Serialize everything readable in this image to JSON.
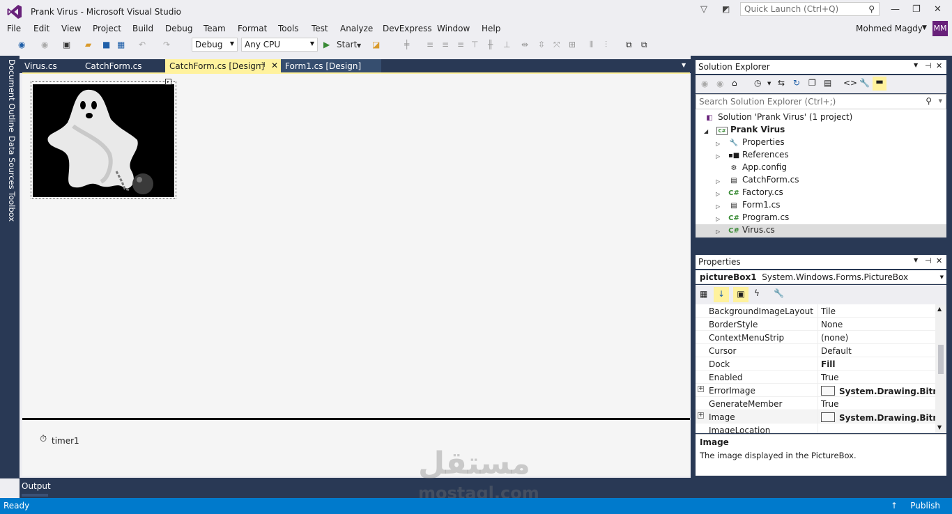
{
  "window": {
    "title": "Prank Virus - Microsoft Visual Studio",
    "quick_launch_placeholder": "Quick Launch (Ctrl+Q)"
  },
  "menu": [
    "File",
    "Edit",
    "View",
    "Project",
    "Build",
    "Debug",
    "Team",
    "Format",
    "Tools",
    "Test",
    "Analyze",
    "DevExpress",
    "Window",
    "Help"
  ],
  "user": {
    "name": "Mohmed Magdy",
    "initials": "MM"
  },
  "toolbar": {
    "config": "Debug",
    "platform": "Any CPU",
    "start": "Start"
  },
  "left_tabs": [
    "Document Outline",
    "Data Sources",
    "Toolbox"
  ],
  "tabs": [
    {
      "label": "Virus.cs"
    },
    {
      "label": "CatchForm.cs"
    },
    {
      "label": "CatchForm.cs [Design]",
      "pin": "⊣",
      "close": "✕"
    },
    {
      "label": "Form1.cs [Design]"
    }
  ],
  "designer": {
    "component": "timer1"
  },
  "output": {
    "label": "Output"
  },
  "status": {
    "left": "Ready",
    "right": "Publish"
  },
  "solution_explorer": {
    "title": "Solution Explorer",
    "search_placeholder": "Search Solution Explorer (Ctrl+;)",
    "items": [
      {
        "label": "Solution 'Prank Virus' (1 project)",
        "icon": "solution-icon"
      },
      {
        "label": "Prank Virus",
        "icon": "csharp-project-icon"
      },
      {
        "label": "Properties",
        "icon": "wrench-icon"
      },
      {
        "label": "References",
        "icon": "references-icon"
      },
      {
        "label": "App.config",
        "icon": "config-icon"
      },
      {
        "label": "CatchForm.cs",
        "icon": "form-icon"
      },
      {
        "label": "Factory.cs",
        "icon": "csharp-file-icon"
      },
      {
        "label": "Form1.cs",
        "icon": "form-icon"
      },
      {
        "label": "Program.cs",
        "icon": "csharp-file-icon"
      },
      {
        "label": "Virus.cs",
        "icon": "csharp-file-icon"
      }
    ]
  },
  "properties": {
    "title": "Properties",
    "object_name": "pictureBox1",
    "object_type": "System.Windows.Forms.PictureBox",
    "rows": [
      {
        "name": "BackgroundImageLayout",
        "value": "Tile"
      },
      {
        "name": "BorderStyle",
        "value": "None"
      },
      {
        "name": "ContextMenuStrip",
        "value": "(none)"
      },
      {
        "name": "Cursor",
        "value": "Default"
      },
      {
        "name": "Dock",
        "value": "Fill"
      },
      {
        "name": "Enabled",
        "value": "True"
      },
      {
        "name": "ErrorImage",
        "value": "System.Drawing.Bitmap"
      },
      {
        "name": "GenerateMember",
        "value": "True"
      },
      {
        "name": "Image",
        "value": "System.Drawing.Bitmap"
      },
      {
        "name": "ImageLocation",
        "value": ""
      }
    ],
    "description_title": "Image",
    "description_text": "The image displayed in the PictureBox."
  },
  "watermark": {
    "line1": "مستقل",
    "line2": "mostaql.com"
  },
  "colors": {
    "accent": "#007acc",
    "frame": "#293955",
    "active_tab": "#fff29d"
  }
}
